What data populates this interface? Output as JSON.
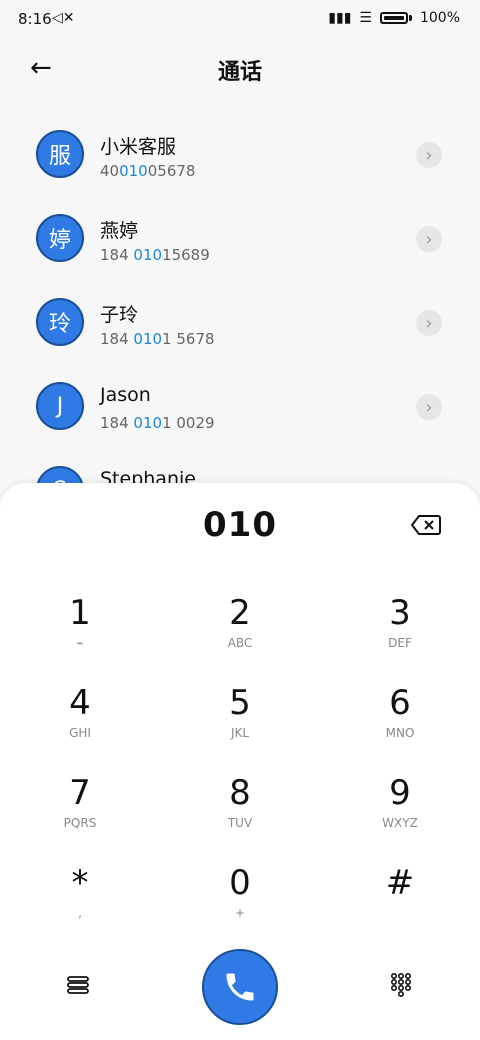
{
  "status": {
    "time": "8:16",
    "mute_icon": "🔇",
    "battery": "100%"
  },
  "header": {
    "back_icon": "←",
    "title": "通话"
  },
  "contacts": [
    {
      "avatar": "服",
      "name": "小米客服",
      "number_prefix": "40",
      "number_hl": "010",
      "number_suffix": "05678"
    },
    {
      "avatar": "婷",
      "name": "燕婷",
      "number_prefix": "184 ",
      "number_hl": "010",
      "number_suffix": "15689"
    },
    {
      "avatar": "玲",
      "name": "子玲",
      "number_prefix": "184 ",
      "number_hl": "010",
      "number_suffix": "1 5678"
    },
    {
      "avatar": "J",
      "name": "Jason",
      "number_prefix": "184 ",
      "number_hl": "010",
      "number_suffix": "1 0029"
    },
    {
      "avatar": "S",
      "name": "Stephanie",
      "number_prefix": "",
      "number_hl": "",
      "number_suffix": ""
    }
  ],
  "dialer": {
    "entered": "010",
    "keys": [
      {
        "d": "1",
        "l": "⌁"
      },
      {
        "d": "2",
        "l": "ABC"
      },
      {
        "d": "3",
        "l": "DEF"
      },
      {
        "d": "4",
        "l": "GHI"
      },
      {
        "d": "5",
        "l": "JKL"
      },
      {
        "d": "6",
        "l": "MNO"
      },
      {
        "d": "7",
        "l": "PQRS"
      },
      {
        "d": "8",
        "l": "TUV"
      },
      {
        "d": "9",
        "l": "WXYZ"
      },
      {
        "d": "*",
        "l": ","
      },
      {
        "d": "0",
        "l": "+"
      },
      {
        "d": "#",
        "l": ""
      }
    ]
  }
}
